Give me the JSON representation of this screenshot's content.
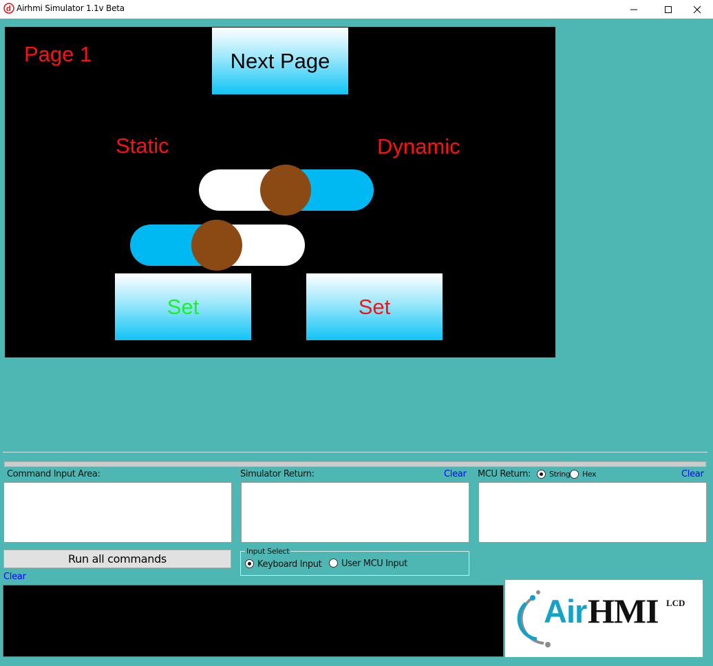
{
  "window": {
    "title": "Airhmi Simulator 1.1v Beta"
  },
  "hmi": {
    "page_label": "Page 1",
    "next_page_button": "Next Page",
    "static_label": "Static",
    "dynamic_label": "Dynamic",
    "set_static_button": "Set",
    "set_dynamic_button": "Set",
    "colors": {
      "screen_bg": "#000000",
      "label_red": "#ff1010",
      "label_green": "#1ef21e",
      "switch_blue": "#00b9f2",
      "switch_white": "#ffffff",
      "knob_brown": "#8b4914"
    }
  },
  "panel": {
    "command_input_label": "Command Input Area:",
    "simulator_return_label": "Simulator Return:",
    "simulator_clear": "Clear",
    "mcu_return_label": "MCU Return:",
    "mcu_string_option": "String",
    "mcu_hex_option": "Hex",
    "mcu_clear": "Clear",
    "run_all_button": "Run all commands",
    "command_clear": "Clear",
    "input_select_legend": "Input Select",
    "keyboard_input_option": "Keyboard Input",
    "user_mcu_input_option": "User MCU Input"
  },
  "logo": {
    "air": "Air",
    "hmi": "HMI",
    "lcd": "LCD"
  }
}
